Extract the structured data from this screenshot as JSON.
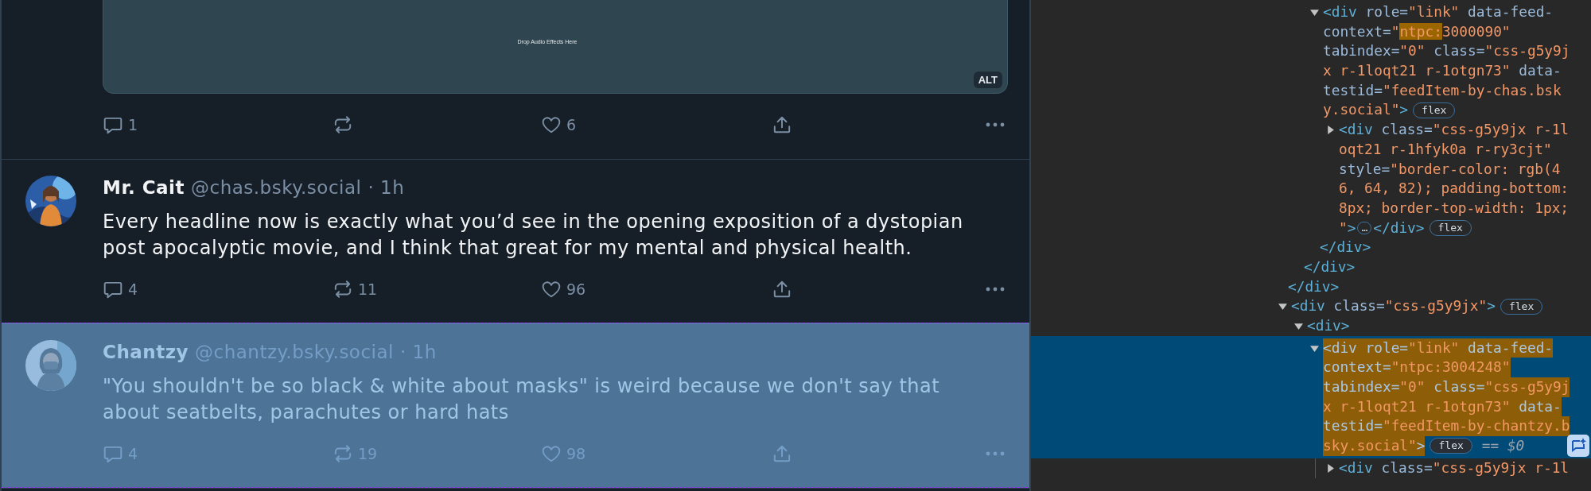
{
  "feed": {
    "posts": [
      {
        "media": {
          "caption": "Drop Audio Effects Here",
          "alt_badge": "ALT"
        },
        "replies": "1",
        "likes": "6",
        "inspected": false
      },
      {
        "author": "Mr. Cait",
        "handle": "@chas.bsky.social",
        "time": "· 1h",
        "text": "Every headline now is exactly what you’d see in the opening exposition of a dystopian post apocalyptic movie, and I think that great for my mental and physical health.",
        "replies": "4",
        "reposts": "11",
        "likes": "96",
        "inspected": false
      },
      {
        "author": "Chantzy",
        "handle": "@chantzy.bsky.social",
        "time": "· 1h",
        "text": "\"You shouldn't be so black & white about masks\" is weird because we don't say that\nabout seatbelts, parachutes or hard hats",
        "replies": "4",
        "reposts": "19",
        "likes": "98",
        "inspected": true
      }
    ]
  },
  "devtools": {
    "nodes": [
      {
        "close": [
          [
            {
              "kind": "tag",
              "text": "</div>"
            }
          ]
        ],
        "children": [
          {
            "close": [
              [
                {
                  "kind": "tag",
                  "text": "</div>"
                }
              ]
            ],
            "children": [
              {
                "expanded": true,
                "selected": false,
                "open": [
                  [
                    {
                      "kind": "tag",
                      "text": "<div"
                    },
                    {
                      "kind": "attr",
                      "text": " role="
                    },
                    {
                      "kind": "value",
                      "text": "\"link\""
                    },
                    {
                      "kind": "attr",
                      "text": " data-feed-"
                    }
                  ],
                  [
                    {
                      "kind": "attr",
                      "text": "context="
                    },
                    {
                      "kind": "value",
                      "text": "\""
                    },
                    {
                      "kind": "match",
                      "text": "ntpc:"
                    },
                    {
                      "kind": "value",
                      "text": "3000090\""
                    }
                  ],
                  [
                    {
                      "kind": "attr",
                      "text": "tabindex="
                    },
                    {
                      "kind": "value",
                      "text": "\"0\""
                    },
                    {
                      "kind": "attr",
                      "text": " class="
                    },
                    {
                      "kind": "value",
                      "text": "\"css-g5y9j"
                    }
                  ],
                  [
                    {
                      "kind": "value",
                      "text": "x r-1loqt21 r-1otgn73\""
                    },
                    {
                      "kind": "attr",
                      "text": " data-"
                    }
                  ],
                  [
                    {
                      "kind": "attr",
                      "text": "testid="
                    },
                    {
                      "kind": "value",
                      "text": "\"feedItem-by-chas.bsk"
                    }
                  ],
                  [
                    {
                      "kind": "value",
                      "text": "y.social\""
                    },
                    {
                      "kind": "tag",
                      "text": ">"
                    },
                    {
                      "kind": "badge",
                      "text": "flex"
                    }
                  ]
                ],
                "close": [
                  [
                    {
                      "kind": "tag",
                      "text": "</div>"
                    }
                  ]
                ],
                "children": [
                  {
                    "expanded": false,
                    "selected": false,
                    "open": [
                      [
                        {
                          "kind": "tag",
                          "text": "<div"
                        },
                        {
                          "kind": "attr",
                          "text": " class="
                        },
                        {
                          "kind": "value",
                          "text": "\"css-g5y9jx r-1l"
                        }
                      ],
                      [
                        {
                          "kind": "value",
                          "text": "oqt21 r-1hfyk0a r-ry3cjt\""
                        }
                      ],
                      [
                        {
                          "kind": "attr",
                          "text": "style="
                        },
                        {
                          "kind": "value",
                          "text": "\"border-color: rgb(4"
                        }
                      ],
                      [
                        {
                          "kind": "value",
                          "text": "6, 64, 82); padding-bottom:"
                        }
                      ],
                      [
                        {
                          "kind": "value",
                          "text": "8px; border-top-width: 1px;"
                        }
                      ],
                      [
                        {
                          "kind": "value",
                          "text": "\""
                        },
                        {
                          "kind": "tag",
                          "text": ">"
                        },
                        {
                          "kind": "dots",
                          "text": "…"
                        },
                        {
                          "kind": "tag",
                          "text": "</div>"
                        },
                        {
                          "kind": "badge",
                          "text": "flex"
                        }
                      ]
                    ]
                  }
                ]
              }
            ]
          }
        ]
      },
      {
        "expanded": true,
        "selected": false,
        "open": [
          [
            {
              "kind": "tag",
              "text": "<div"
            },
            {
              "kind": "attr",
              "text": " class="
            },
            {
              "kind": "value",
              "text": "\"css-g5y9jx\""
            },
            {
              "kind": "tag",
              "text": ">"
            },
            {
              "kind": "badge",
              "text": "flex"
            }
          ]
        ],
        "children": [
          {
            "expanded": true,
            "selected": false,
            "open": [
              [
                {
                  "kind": "tag",
                  "text": "<div>"
                }
              ]
            ],
            "children": [
              {
                "expanded": true,
                "selected": true,
                "open": [
                  [
                    {
                      "kind": "tag",
                      "text": "<div"
                    },
                    {
                      "kind": "attr",
                      "text": " role="
                    },
                    {
                      "kind": "value",
                      "text": "\"link\""
                    },
                    {
                      "kind": "attr",
                      "text": " data-feed-"
                    }
                  ],
                  [
                    {
                      "kind": "attr",
                      "text": "context="
                    },
                    {
                      "kind": "value",
                      "text": "\"ntpc:3004248\""
                    }
                  ],
                  [
                    {
                      "kind": "attr",
                      "text": "tabindex="
                    },
                    {
                      "kind": "value",
                      "text": "\"0\""
                    },
                    {
                      "kind": "attr",
                      "text": " class="
                    },
                    {
                      "kind": "value",
                      "text": "\"css-g5y9j"
                    }
                  ],
                  [
                    {
                      "kind": "value",
                      "text": "x r-1loqt21 r-1otgn73\""
                    },
                    {
                      "kind": "attr",
                      "text": " data-"
                    }
                  ],
                  [
                    {
                      "kind": "attr",
                      "text": "testid="
                    },
                    {
                      "kind": "value",
                      "text": "\"feedItem-by-chantzy.b"
                    }
                  ],
                  [
                    {
                      "kind": "value",
                      "text": "sky.social\""
                    },
                    {
                      "kind": "tag",
                      "text": ">"
                    },
                    {
                      "kind": "badge",
                      "text": "flex"
                    },
                    {
                      "kind": "ref",
                      "text": "== $0"
                    }
                  ]
                ],
                "children": [
                  {
                    "expanded": false,
                    "selected": false,
                    "open": [
                      [
                        {
                          "kind": "tag",
                          "text": "<div"
                        },
                        {
                          "kind": "attr",
                          "text": " class="
                        },
                        {
                          "kind": "value",
                          "text": "\"css-g5y9jx r-1l"
                        }
                      ]
                    ]
                  }
                ]
              }
            ]
          }
        ]
      }
    ]
  }
}
